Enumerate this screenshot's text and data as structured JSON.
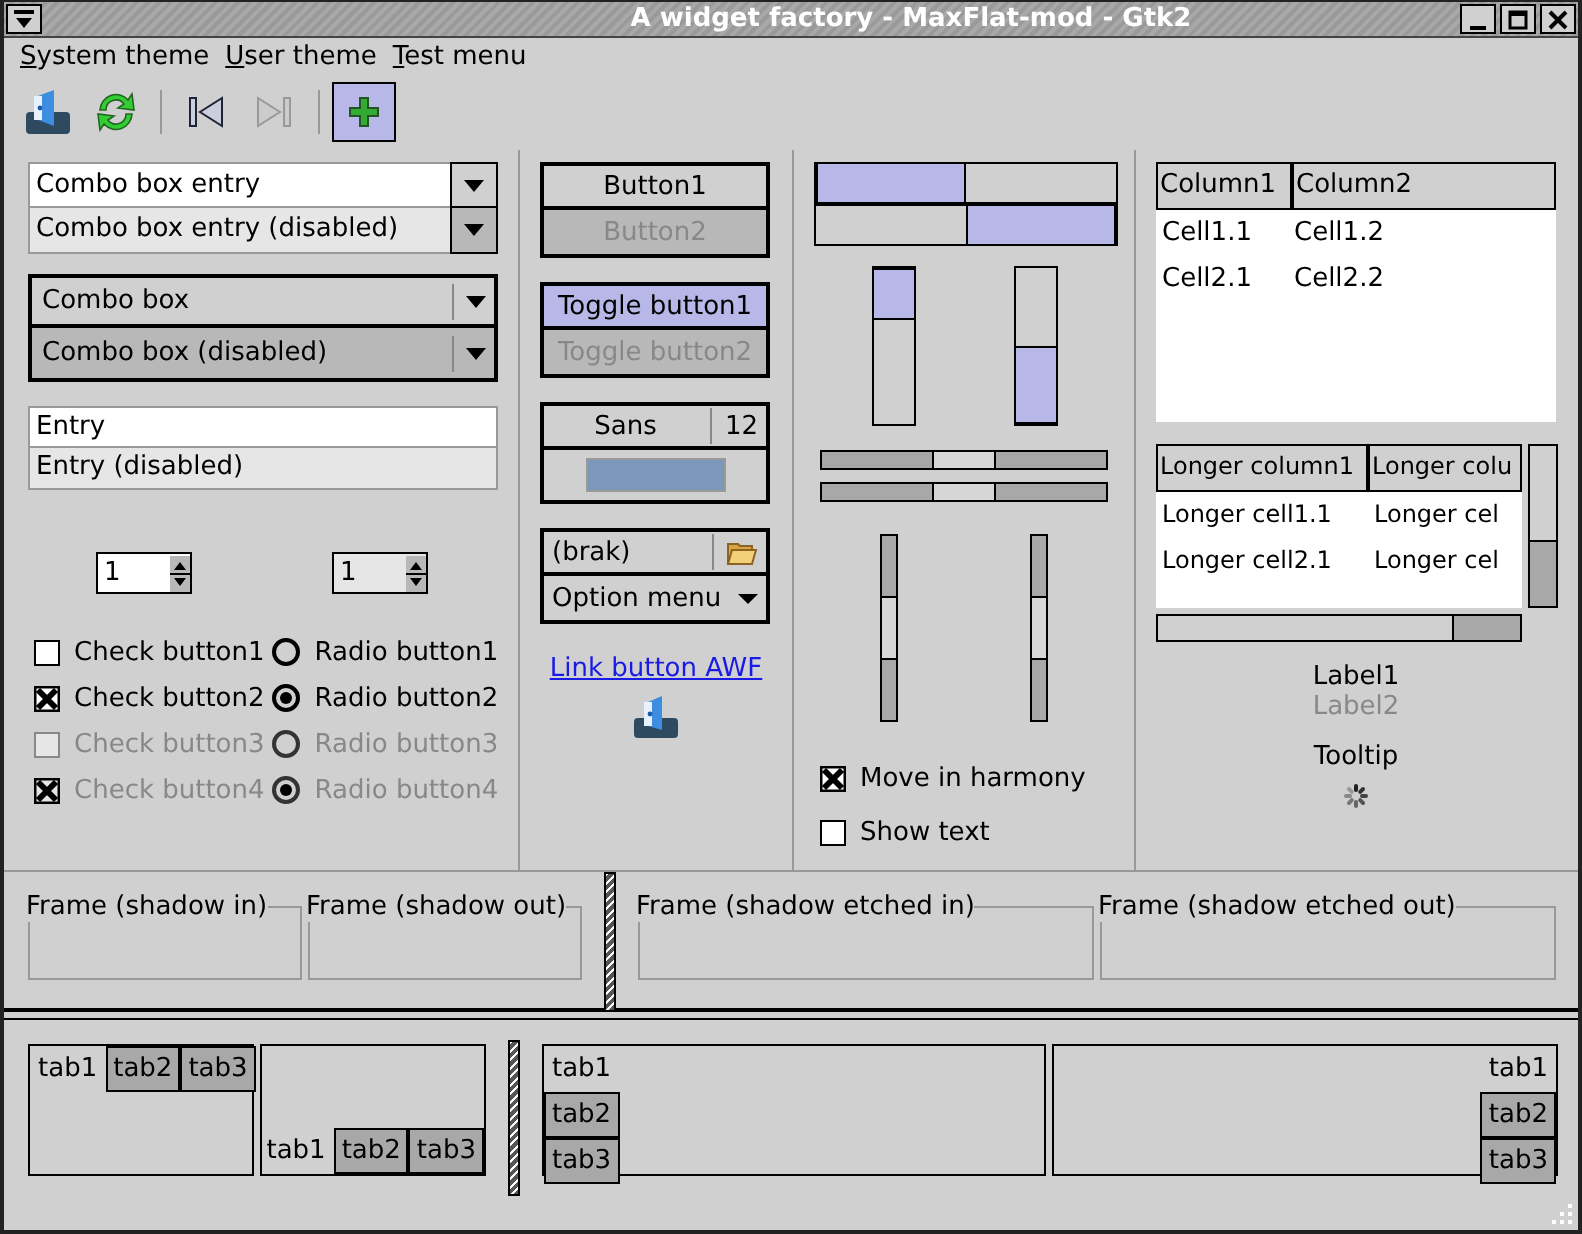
{
  "window": {
    "title": "A widget factory - MaxFlat-mod - Gtk2"
  },
  "menu": [
    "System theme",
    "User theme",
    "Test menu"
  ],
  "toolbar": [
    {
      "kind": "app",
      "active": false
    },
    {
      "kind": "refresh",
      "active": false
    },
    {
      "kind": "separator"
    },
    {
      "kind": "first",
      "disabled": false,
      "active": false
    },
    {
      "kind": "last",
      "disabled": true,
      "active": false
    },
    {
      "kind": "separator"
    },
    {
      "kind": "add",
      "active": true
    }
  ],
  "combo_entries": [
    {
      "value": "Combo box entry",
      "disabled": false
    },
    {
      "value": "Combo box entry (disabled)",
      "disabled": true
    }
  ],
  "combo_boxes": [
    {
      "value": "Combo box",
      "disabled": false
    },
    {
      "value": "Combo box (disabled)",
      "disabled": true
    }
  ],
  "entries": [
    {
      "value": "Entry",
      "disabled": false
    },
    {
      "value": "Entry (disabled)",
      "disabled": true
    }
  ],
  "spin_buttons": [
    {
      "value": "1",
      "disabled": false
    },
    {
      "value": "1",
      "disabled": true
    }
  ],
  "check_buttons": [
    {
      "label": "Check button1",
      "checked": false,
      "disabled": false
    },
    {
      "label": "Check button2",
      "checked": true,
      "disabled": false
    },
    {
      "label": "Check button3",
      "checked": false,
      "disabled": true
    },
    {
      "label": "Check button4",
      "checked": true,
      "disabled": true
    }
  ],
  "radio_buttons": [
    {
      "label": "Radio button1",
      "selected": false,
      "disabled": false
    },
    {
      "label": "Radio button2",
      "selected": true,
      "disabled": false
    },
    {
      "label": "Radio button3",
      "selected": false,
      "disabled": true
    },
    {
      "label": "Radio button4",
      "selected": true,
      "disabled": true
    }
  ],
  "buttons": [
    {
      "label": "Button1",
      "disabled": false
    },
    {
      "label": "Button2",
      "disabled": true
    }
  ],
  "toggle_buttons": [
    {
      "label": "Toggle button1",
      "on": true,
      "disabled": false
    },
    {
      "label": "Toggle button2",
      "on": false,
      "disabled": true
    }
  ],
  "font_button": {
    "family": "Sans",
    "size": "12"
  },
  "color_button": {
    "color": "#7b97b9"
  },
  "file_chooser": {
    "value": "(brak)"
  },
  "option_menu": {
    "label": "Option menu"
  },
  "link_button": {
    "label": "Link button AWF"
  },
  "horizontal_progress_bars": [
    {
      "inverted": false,
      "level": 0.5
    },
    {
      "inverted": true,
      "level": 0.5
    }
  ],
  "vertical_progress_bars": [
    {
      "inverted": false,
      "level": 0.33
    },
    {
      "inverted": true,
      "level": 0.5
    }
  ],
  "harmony_checks": [
    {
      "label": "Move in harmony",
      "checked": true
    },
    {
      "label": "Show text",
      "checked": false
    }
  ],
  "tree_view": {
    "columns": [
      "Column1",
      "Column2"
    ],
    "rows": [
      [
        "Cell1.1",
        "Cell1.2"
      ],
      [
        "Cell2.1",
        "Cell2.2"
      ]
    ]
  },
  "scrolled_tree_view": {
    "columns": [
      "Longer column1",
      "Longer colu"
    ],
    "rows": [
      [
        "Longer cell1.1",
        "Longer cel"
      ],
      [
        "Longer cell2.1",
        "Longer cel"
      ]
    ]
  },
  "labels": [
    {
      "text": "Label1",
      "disabled": false
    },
    {
      "text": "Label2",
      "disabled": true
    }
  ],
  "tooltip_label": "Tooltip",
  "frames": [
    "Frame (shadow in)",
    "Frame (shadow out)",
    "Frame (shadow etched in)",
    "Frame (shadow etched out)"
  ],
  "notebooks": [
    {
      "kind": "top",
      "tabs": [
        {
          "label": "tab1",
          "selected": true
        },
        {
          "label": "tab2",
          "selected": false
        },
        {
          "label": "tab3",
          "selected": false
        }
      ]
    },
    {
      "kind": "bottom",
      "tabs": [
        {
          "label": "tab1",
          "selected": true
        },
        {
          "label": "tab2",
          "selected": false
        },
        {
          "label": "tab3",
          "selected": false
        }
      ]
    },
    {
      "kind": "left",
      "tabs": [
        {
          "label": "tab1",
          "selected": true
        },
        {
          "label": "tab2",
          "selected": false
        },
        {
          "label": "tab3",
          "selected": false
        }
      ]
    },
    {
      "kind": "right",
      "tabs": [
        {
          "label": "tab1",
          "selected": true
        },
        {
          "label": "tab2",
          "selected": false
        },
        {
          "label": "tab3",
          "selected": false
        }
      ]
    }
  ]
}
